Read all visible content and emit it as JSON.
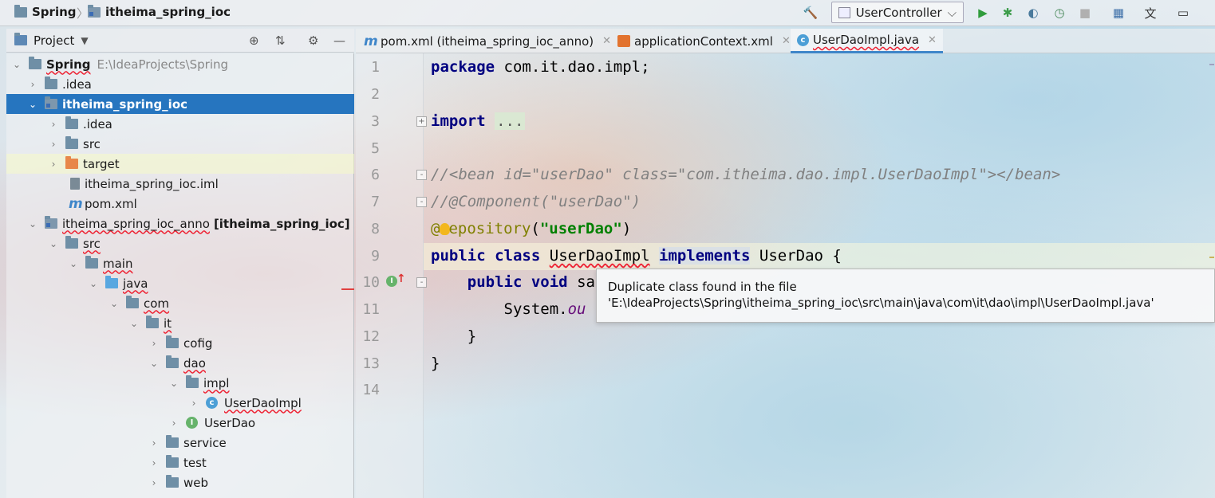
{
  "navbar": {
    "breadcrumbs": [
      {
        "label": "Spring",
        "icon": "folder-icon"
      },
      {
        "label": "itheima_spring_ioc",
        "icon": "module-folder-icon"
      }
    ],
    "run_config": "UserController",
    "toolbar_icons": [
      "build-hammer-icon",
      "run-icon",
      "debug-icon",
      "coverage-icon",
      "profile-icon",
      "stop-icon",
      "project-structure-icon",
      "translate-icon",
      "window-icon"
    ]
  },
  "project_panel": {
    "title": "Project",
    "tree": [
      {
        "label": "Spring",
        "path": "E:\\IdeaProjects\\Spring"
      },
      {
        "label": ".idea"
      },
      {
        "label": "itheima_spring_ioc"
      },
      {
        "label": ".idea"
      },
      {
        "label": "src"
      },
      {
        "label": "target"
      },
      {
        "label": "itheima_spring_ioc.iml"
      },
      {
        "label": "pom.xml"
      },
      {
        "label": "itheima_spring_ioc_anno",
        "suffix": "[itheima_spring_ioc]"
      },
      {
        "label": "src"
      },
      {
        "label": "main"
      },
      {
        "label": "java"
      },
      {
        "label": "com"
      },
      {
        "label": "it"
      },
      {
        "label": "cofig"
      },
      {
        "label": "dao"
      },
      {
        "label": "impl"
      },
      {
        "label": "UserDaoImpl"
      },
      {
        "label": "UserDao"
      },
      {
        "label": "service"
      },
      {
        "label": "test"
      },
      {
        "label": "web"
      }
    ]
  },
  "tabs": [
    {
      "label": "pom.xml (itheima_spring_ioc_anno)",
      "icon": "maven-icon"
    },
    {
      "label": "applicationContext.xml",
      "icon": "xml-icon"
    },
    {
      "label": "UserDaoImpl.java",
      "icon": "class-icon",
      "active": true
    }
  ],
  "editor": {
    "line_numbers": [
      "1",
      "2",
      "3",
      "5",
      "6",
      "7",
      "8",
      "9",
      "10",
      "11",
      "12",
      "13",
      "14"
    ],
    "code": {
      "l1_kw": "package",
      "l1_rest": " com.it.dao.impl;",
      "l3_kw": "import",
      "l3_fold": "...",
      "l6": "//<bean id=\"userDao\" class=\"com.itheima.dao.impl.UserDaoImpl\"></bean>",
      "l7": "//@Component(\"userDao\")",
      "l8_at": "@",
      "l8_ann": "epository",
      "l8_open": "(",
      "l8_str": "\"userDao\"",
      "l8_close": ")",
      "l9_kw1": "public",
      "l9_kw2": "class",
      "l9_name": "UserDaoImpl",
      "l9_kw3": "implements",
      "l9_iface": "UserDao {",
      "l10_kw1": "public",
      "l10_kw2": "void",
      "l10_rest": "sa",
      "l11_obj": "System.",
      "l11_field": "ou",
      "l12": "}",
      "l13": "}"
    },
    "tooltip": {
      "line1": "Duplicate class found in the file",
      "line2": "'E:\\IdeaProjects\\Spring\\itheima_spring_ioc\\src\\main\\java\\com\\it\\dao\\impl\\UserDaoImpl.java'"
    }
  }
}
